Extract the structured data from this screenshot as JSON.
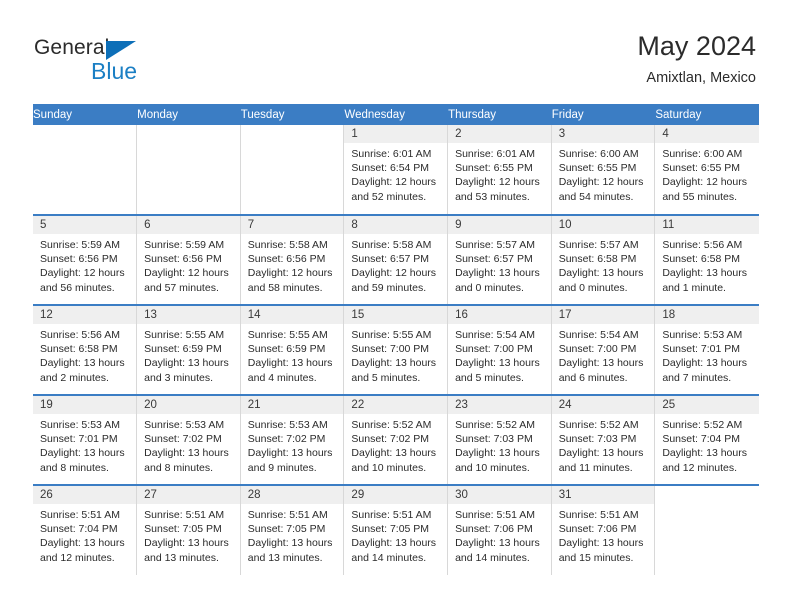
{
  "brand": {
    "name_part1": "General",
    "name_part2": "Blue",
    "accent_color": "#1b7fc4",
    "triangle_color": "#0d6fb8"
  },
  "header": {
    "title": "May 2024",
    "subtitle": "Amixtlan, Mexico",
    "header_bg_color": "#3b7dc4",
    "daynum_bg_color": "#efefef"
  },
  "weekdays": [
    "Sunday",
    "Monday",
    "Tuesday",
    "Wednesday",
    "Thursday",
    "Friday",
    "Saturday"
  ],
  "weeks": [
    [
      {
        "day": "",
        "sunrise": "",
        "sunset": "",
        "daylight": ""
      },
      {
        "day": "",
        "sunrise": "",
        "sunset": "",
        "daylight": ""
      },
      {
        "day": "",
        "sunrise": "",
        "sunset": "",
        "daylight": ""
      },
      {
        "day": "1",
        "sunrise": "Sunrise: 6:01 AM",
        "sunset": "Sunset: 6:54 PM",
        "daylight": "Daylight: 12 hours and 52 minutes."
      },
      {
        "day": "2",
        "sunrise": "Sunrise: 6:01 AM",
        "sunset": "Sunset: 6:55 PM",
        "daylight": "Daylight: 12 hours and 53 minutes."
      },
      {
        "day": "3",
        "sunrise": "Sunrise: 6:00 AM",
        "sunset": "Sunset: 6:55 PM",
        "daylight": "Daylight: 12 hours and 54 minutes."
      },
      {
        "day": "4",
        "sunrise": "Sunrise: 6:00 AM",
        "sunset": "Sunset: 6:55 PM",
        "daylight": "Daylight: 12 hours and 55 minutes."
      }
    ],
    [
      {
        "day": "5",
        "sunrise": "Sunrise: 5:59 AM",
        "sunset": "Sunset: 6:56 PM",
        "daylight": "Daylight: 12 hours and 56 minutes."
      },
      {
        "day": "6",
        "sunrise": "Sunrise: 5:59 AM",
        "sunset": "Sunset: 6:56 PM",
        "daylight": "Daylight: 12 hours and 57 minutes."
      },
      {
        "day": "7",
        "sunrise": "Sunrise: 5:58 AM",
        "sunset": "Sunset: 6:56 PM",
        "daylight": "Daylight: 12 hours and 58 minutes."
      },
      {
        "day": "8",
        "sunrise": "Sunrise: 5:58 AM",
        "sunset": "Sunset: 6:57 PM",
        "daylight": "Daylight: 12 hours and 59 minutes."
      },
      {
        "day": "9",
        "sunrise": "Sunrise: 5:57 AM",
        "sunset": "Sunset: 6:57 PM",
        "daylight": "Daylight: 13 hours and 0 minutes."
      },
      {
        "day": "10",
        "sunrise": "Sunrise: 5:57 AM",
        "sunset": "Sunset: 6:58 PM",
        "daylight": "Daylight: 13 hours and 0 minutes."
      },
      {
        "day": "11",
        "sunrise": "Sunrise: 5:56 AM",
        "sunset": "Sunset: 6:58 PM",
        "daylight": "Daylight: 13 hours and 1 minute."
      }
    ],
    [
      {
        "day": "12",
        "sunrise": "Sunrise: 5:56 AM",
        "sunset": "Sunset: 6:58 PM",
        "daylight": "Daylight: 13 hours and 2 minutes."
      },
      {
        "day": "13",
        "sunrise": "Sunrise: 5:55 AM",
        "sunset": "Sunset: 6:59 PM",
        "daylight": "Daylight: 13 hours and 3 minutes."
      },
      {
        "day": "14",
        "sunrise": "Sunrise: 5:55 AM",
        "sunset": "Sunset: 6:59 PM",
        "daylight": "Daylight: 13 hours and 4 minutes."
      },
      {
        "day": "15",
        "sunrise": "Sunrise: 5:55 AM",
        "sunset": "Sunset: 7:00 PM",
        "daylight": "Daylight: 13 hours and 5 minutes."
      },
      {
        "day": "16",
        "sunrise": "Sunrise: 5:54 AM",
        "sunset": "Sunset: 7:00 PM",
        "daylight": "Daylight: 13 hours and 5 minutes."
      },
      {
        "day": "17",
        "sunrise": "Sunrise: 5:54 AM",
        "sunset": "Sunset: 7:00 PM",
        "daylight": "Daylight: 13 hours and 6 minutes."
      },
      {
        "day": "18",
        "sunrise": "Sunrise: 5:53 AM",
        "sunset": "Sunset: 7:01 PM",
        "daylight": "Daylight: 13 hours and 7 minutes."
      }
    ],
    [
      {
        "day": "19",
        "sunrise": "Sunrise: 5:53 AM",
        "sunset": "Sunset: 7:01 PM",
        "daylight": "Daylight: 13 hours and 8 minutes."
      },
      {
        "day": "20",
        "sunrise": "Sunrise: 5:53 AM",
        "sunset": "Sunset: 7:02 PM",
        "daylight": "Daylight: 13 hours and 8 minutes."
      },
      {
        "day": "21",
        "sunrise": "Sunrise: 5:53 AM",
        "sunset": "Sunset: 7:02 PM",
        "daylight": "Daylight: 13 hours and 9 minutes."
      },
      {
        "day": "22",
        "sunrise": "Sunrise: 5:52 AM",
        "sunset": "Sunset: 7:02 PM",
        "daylight": "Daylight: 13 hours and 10 minutes."
      },
      {
        "day": "23",
        "sunrise": "Sunrise: 5:52 AM",
        "sunset": "Sunset: 7:03 PM",
        "daylight": "Daylight: 13 hours and 10 minutes."
      },
      {
        "day": "24",
        "sunrise": "Sunrise: 5:52 AM",
        "sunset": "Sunset: 7:03 PM",
        "daylight": "Daylight: 13 hours and 11 minutes."
      },
      {
        "day": "25",
        "sunrise": "Sunrise: 5:52 AM",
        "sunset": "Sunset: 7:04 PM",
        "daylight": "Daylight: 13 hours and 12 minutes."
      }
    ],
    [
      {
        "day": "26",
        "sunrise": "Sunrise: 5:51 AM",
        "sunset": "Sunset: 7:04 PM",
        "daylight": "Daylight: 13 hours and 12 minutes."
      },
      {
        "day": "27",
        "sunrise": "Sunrise: 5:51 AM",
        "sunset": "Sunset: 7:05 PM",
        "daylight": "Daylight: 13 hours and 13 minutes."
      },
      {
        "day": "28",
        "sunrise": "Sunrise: 5:51 AM",
        "sunset": "Sunset: 7:05 PM",
        "daylight": "Daylight: 13 hours and 13 minutes."
      },
      {
        "day": "29",
        "sunrise": "Sunrise: 5:51 AM",
        "sunset": "Sunset: 7:05 PM",
        "daylight": "Daylight: 13 hours and 14 minutes."
      },
      {
        "day": "30",
        "sunrise": "Sunrise: 5:51 AM",
        "sunset": "Sunset: 7:06 PM",
        "daylight": "Daylight: 13 hours and 14 minutes."
      },
      {
        "day": "31",
        "sunrise": "Sunrise: 5:51 AM",
        "sunset": "Sunset: 7:06 PM",
        "daylight": "Daylight: 13 hours and 15 minutes."
      },
      {
        "day": "",
        "sunrise": "",
        "sunset": "",
        "daylight": ""
      }
    ]
  ]
}
